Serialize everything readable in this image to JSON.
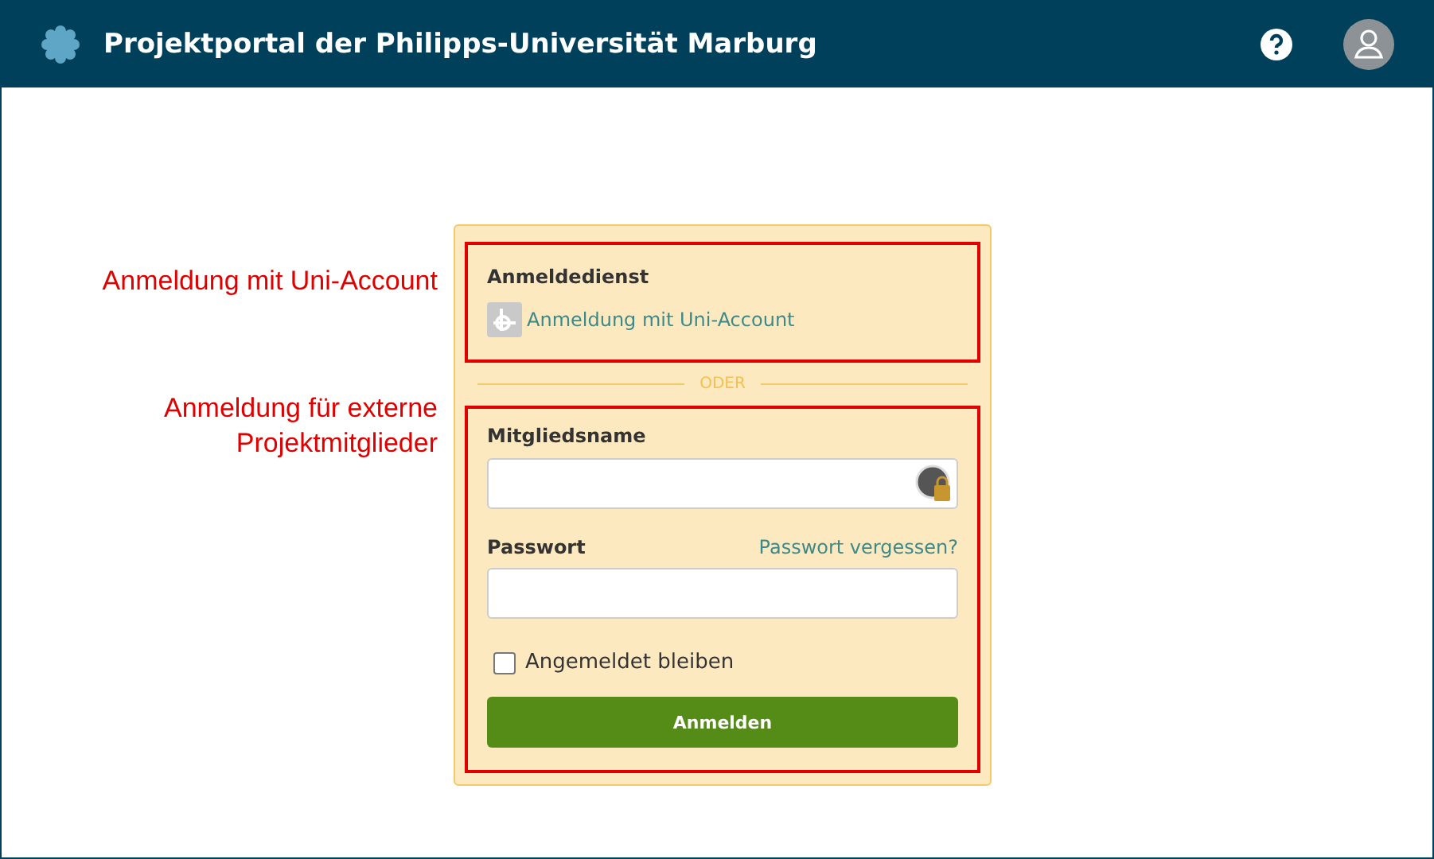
{
  "header": {
    "title": "Projektportal der Philipps-Universität Marburg"
  },
  "annotations": [
    "Anmeldung mit Uni-Account",
    "Anmeldung für externe Projektmitglieder"
  ],
  "login": {
    "service_label": "Anmeldedienst",
    "service_link": "Anmeldung mit Uni-Account",
    "divider": "ODER",
    "username_label": "Mitgliedsname",
    "password_label": "Passwort",
    "forgot_link": "Passwort vergessen?",
    "remember": {
      "label": "Angemeldet bleiben",
      "checked": false
    },
    "submit": "Anmelden"
  }
}
